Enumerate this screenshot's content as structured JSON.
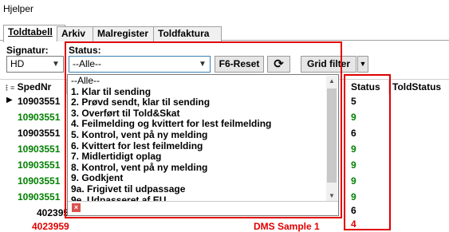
{
  "menu": {
    "title": "Hjelper"
  },
  "tabs": [
    {
      "label": "Toldtabell"
    },
    {
      "label": "Arkiv"
    },
    {
      "label": "Malregister"
    },
    {
      "label": "Toldfaktura"
    }
  ],
  "filters": {
    "signatur_label": "Signatur:",
    "signatur_value": "HD",
    "status_label": "Status:",
    "status_value": "--Alle--",
    "reset_label": "F6-Reset",
    "grid_filter_label": "Grid filter"
  },
  "grid": {
    "columns": [
      "SpedNr",
      "Status",
      "ToldStatus"
    ],
    "rows": [
      {
        "spednr": "10903551",
        "status": "5",
        "color": "#000000"
      },
      {
        "spednr": "10903551",
        "status": "9",
        "color": "#008000"
      },
      {
        "spednr": "10903551",
        "status": "6",
        "color": "#000000"
      },
      {
        "spednr": "10903551",
        "status": "9",
        "color": "#008000"
      },
      {
        "spednr": "10903551",
        "status": "9",
        "color": "#008000"
      },
      {
        "spednr": "10903551",
        "status": "9",
        "color": "#008000"
      },
      {
        "spednr": "10903551",
        "status": "9",
        "color": "#008000"
      },
      {
        "spednr": "402395",
        "status": "6",
        "color": "#000000"
      },
      {
        "spednr": "4023959",
        "note": "DMS Sample 1",
        "status": "4",
        "color": "#e00000"
      }
    ]
  },
  "status_options": [
    "--Alle--",
    "1. Klar til sending",
    "2. Prøvd sendt, klar til sending",
    "3. Overført til Told&Skat",
    "4. Feilmelding og kvittert for lest feilmelding",
    "5. Kontrol, vent på ny melding",
    "6. Kvittert for lest feilmelding",
    "7. Midlertidigt oplag",
    "8. Kontrol, vent på ny melding",
    "9. Godkjent",
    "9a. Frigivet til udpassage",
    "9e. Udpasseret af EU"
  ],
  "colors": {
    "highlight_red": "#e00000",
    "green": "#008000"
  }
}
